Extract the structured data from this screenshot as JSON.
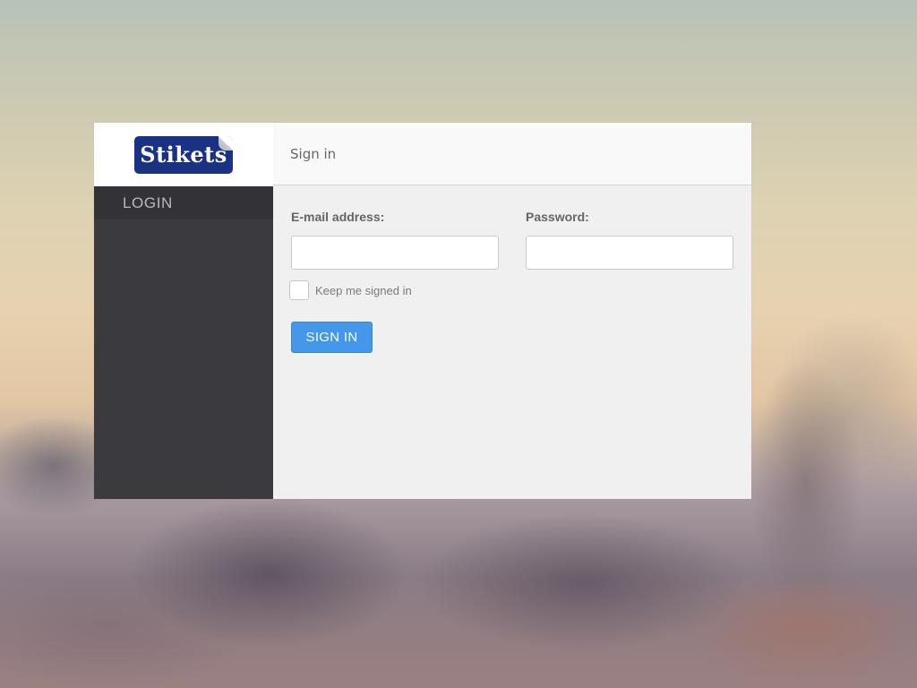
{
  "logo": {
    "text": "Stikets",
    "background_color": "#1a3284"
  },
  "sidebar": {
    "items": [
      {
        "label": "LOGIN"
      }
    ]
  },
  "header": {
    "title": "Sign in"
  },
  "form": {
    "email": {
      "label": "E-mail address:",
      "value": "",
      "placeholder": ""
    },
    "password": {
      "label": "Password:",
      "value": "",
      "placeholder": ""
    },
    "remember": {
      "label": "Keep me signed in",
      "checked": false
    },
    "submit_label": "SIGN IN"
  },
  "colors": {
    "accent": "#4597ec",
    "sidebar": "#3b3a3e"
  }
}
